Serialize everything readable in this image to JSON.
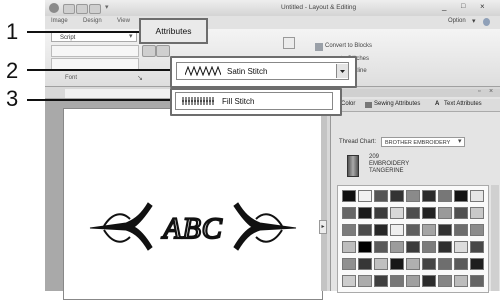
{
  "window": {
    "title": "Untitled - Layout & Editing",
    "controls": [
      "_",
      "□",
      "×"
    ]
  },
  "ribbon": {
    "tabs": [
      "Image",
      "Design",
      "View"
    ],
    "active_tab": "Attributes",
    "option_label": "Option",
    "font_value": "Script",
    "font_group_label": "Font",
    "convert_labels": [
      "Convert to Blocks",
      "to Stitches",
      "to Outline"
    ]
  },
  "callouts": [
    "1",
    "2",
    "3"
  ],
  "stitch_dropdown": {
    "selected": "Satin Stitch",
    "highlighted_option": "Fill Stitch"
  },
  "side_panel": {
    "tabs": [
      "Color",
      "Sewing Attributes",
      "Text Attributes"
    ],
    "thread_chart_label": "Thread Chart:",
    "thread_chart_value": "BROTHER EMBROIDERY",
    "thread_number": "209",
    "thread_brand": "EMBROIDERY",
    "thread_name": "TANGERINE",
    "swatch_colors": [
      [
        "#101010",
        "#f2f2f2",
        "#555555",
        "#333333",
        "#8a8a8a",
        "#2a2a2a",
        "#777777",
        "#121212",
        "#e6e6e6"
      ],
      [
        "#666666",
        "#1a1a1a",
        "#3c3c3c",
        "#d8d8d8",
        "#4d4d4d",
        "#222222",
        "#9a9a9a",
        "#505050",
        "#c8c8c8"
      ],
      [
        "#7a7a7a",
        "#4a4a4a",
        "#262626",
        "#eeeeee",
        "#5e5e5e",
        "#a4a4a4",
        "#303030",
        "#6b6b6b",
        "#8c8c8c"
      ],
      [
        "#bdbdbd",
        "#000000",
        "#595959",
        "#9c9c9c",
        "#3a3a3a",
        "#7c7c7c",
        "#2e2e2e",
        "#dcdcdc",
        "#474747"
      ],
      [
        "#909090",
        "#363636",
        "#c0c0c0",
        "#171717",
        "#b0b0b0",
        "#444444",
        "#6e6e6e",
        "#5a5a5a",
        "#1e1e1e"
      ],
      [
        "#cccccc",
        "#acacac",
        "#3e3e3e",
        "#767676",
        "#a0a0a0",
        "#2c2c2c",
        "#858585",
        "#bcbcbc",
        "#646464"
      ]
    ]
  },
  "canvas": {
    "monogram": "ABC"
  }
}
